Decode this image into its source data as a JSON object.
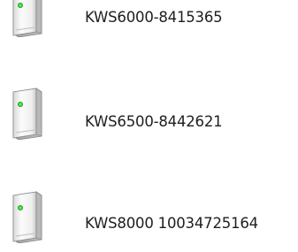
{
  "devices": [
    {
      "name": "KWS6000-8415365",
      "icon": "server-tower-icon"
    },
    {
      "name": "KWS6500-8442621",
      "icon": "server-tower-icon"
    },
    {
      "name": "KWS8000 10034725164",
      "icon": "server-tower-icon"
    }
  ],
  "colors": {
    "background": "#ffffff",
    "text": "#1e1e1e",
    "tower_body": "#f2f2f2",
    "tower_edge": "#8a8a8a",
    "status_led": "#2fd12f"
  }
}
